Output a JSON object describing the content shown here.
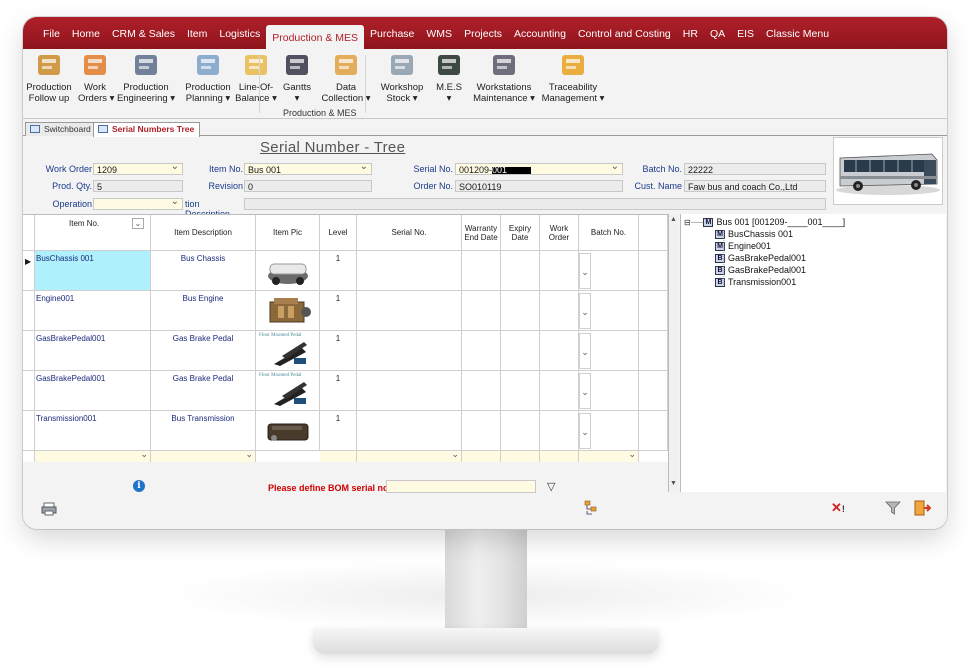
{
  "menu": {
    "items": [
      "File",
      "Home",
      "CRM & Sales",
      "Item",
      "Logistics",
      "Production & MES",
      "Purchase",
      "WMS",
      "Projects",
      "Accounting",
      "Control and Costing",
      "HR",
      "QA",
      "EIS",
      "Classic Menu"
    ],
    "active": "Production & MES"
  },
  "ribbon": {
    "buttons": [
      {
        "line1": "Production",
        "line2": "Follow up",
        "icon": "production-followup-icon"
      },
      {
        "line1": "Work",
        "line2": "Orders ▾",
        "icon": "work-orders-icon"
      },
      {
        "line1": "Production",
        "line2": "Engineering ▾",
        "icon": "production-engineering-icon"
      },
      {
        "line1": "Production",
        "line2": "Planning ▾",
        "icon": "production-planning-icon"
      },
      {
        "line1": "Line-Of-",
        "line2": "Balance ▾",
        "icon": "line-of-balance-icon"
      },
      {
        "line1": "Gantts",
        "line2": "▾",
        "icon": "gantts-icon"
      },
      {
        "line1": "Data",
        "line2": "Collection ▾",
        "icon": "data-collection-icon"
      },
      {
        "line1": "Workshop",
        "line2": "Stock ▾",
        "icon": "workshop-stock-icon"
      },
      {
        "line1": "M.E.S",
        "line2": "▾",
        "icon": "mes-icon"
      },
      {
        "line1": "Workstations",
        "line2": "Maintenance ▾",
        "icon": "workstations-maintenance-icon"
      },
      {
        "line1": "Traceability",
        "line2": "Management ▾",
        "icon": "traceability-management-icon"
      }
    ],
    "group_label": "Production & MES"
  },
  "tabs": [
    {
      "label": "Switchboard",
      "active": false
    },
    {
      "label": "Serial Numbers Tree",
      "active": true
    }
  ],
  "form": {
    "title": "Serial Number - Tree",
    "work_order_label": "Work Order",
    "work_order": "1209",
    "item_no_label": "Item No.",
    "item_no": "Bus 001",
    "serial_no_label": "Serial No.",
    "serial_no_prefix": "001209-",
    "serial_no_suffix": "001",
    "batch_no_label": "Batch No.",
    "batch_no": "22222",
    "prod_qty_label": "Prod. Qty.",
    "prod_qty": "5",
    "revision_label": "Revision",
    "revision": "0",
    "order_no_label": "Order No.",
    "order_no": "SO010119",
    "cust_name_label": "Cust. Name",
    "cust_name": "Faw bus and coach Co.,Ltd",
    "operation_label": "Operation",
    "operation_desc_label": "tion Description"
  },
  "grid": {
    "headers": [
      "Item No.",
      "Item Description",
      "Item Pic",
      "Level",
      "Serial No.",
      "Warranty End Date",
      "Expiry Date",
      "Work Order",
      "Batch No."
    ],
    "rows": [
      {
        "item_no": "BusChassis 001",
        "desc": "Bus Chassis",
        "pic": "chassis",
        "level": "1"
      },
      {
        "item_no": "Engine001",
        "desc": "Bus Engine",
        "pic": "engine",
        "level": "1"
      },
      {
        "item_no": "GasBrakePedal001",
        "desc": "Gas Brake Pedal",
        "pic": "pedal",
        "level": "1",
        "pic_caption": "Floor Mounted Pedal"
      },
      {
        "item_no": "GasBrakePedal001",
        "desc": "Gas Brake Pedal",
        "pic": "pedal",
        "level": "1",
        "pic_caption": "Floor Mounted Pedal"
      },
      {
        "item_no": "Transmission001",
        "desc": "Bus Transmission",
        "pic": "transmission",
        "level": "1"
      }
    ]
  },
  "tree": {
    "root": {
      "badge": "M",
      "label": "Bus 001 [001209-____001____]"
    },
    "children": [
      {
        "badge": "M",
        "label": "BusChassis 001"
      },
      {
        "badge": "M",
        "label": "Engine001"
      },
      {
        "badge": "B",
        "label": "GasBrakePedal001"
      },
      {
        "badge": "B",
        "label": "GasBrakePedal001"
      },
      {
        "badge": "B",
        "label": "Transmission001"
      }
    ]
  },
  "footer": {
    "warning": "Please define BOM serial no."
  },
  "colors": {
    "brand": "#a81b24",
    "field_yellow": "#fffbe3",
    "selected_row": "#aef0fb",
    "label_blue": "#1a3a8a"
  }
}
